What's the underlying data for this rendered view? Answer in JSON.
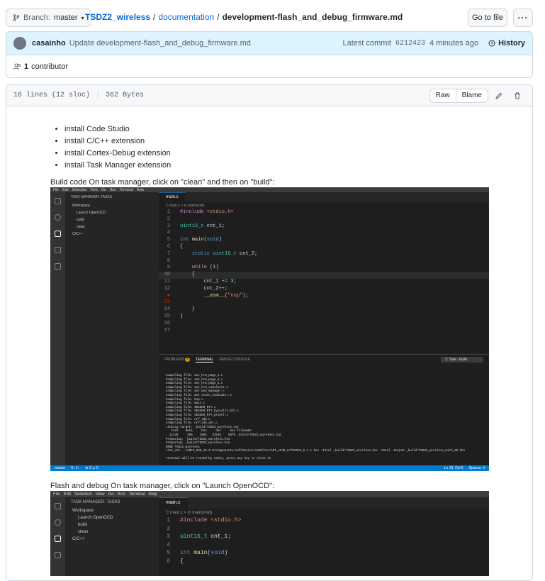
{
  "header": {
    "branch_label": "Branch:",
    "branch_name": "master",
    "repo": "TSDZ2_wireless",
    "folder": "documentation",
    "filename": "development-flash_and_debug_firmware.md",
    "goto_label": "Go to file",
    "more_label": "···"
  },
  "commit": {
    "user": "casainho",
    "message": "Update development-flash_and_debug_firmware.md",
    "latest_label": "Latest commit",
    "sha": "6212423",
    "time": "4 minutes ago",
    "history_label": "History"
  },
  "contributors": {
    "count": "1",
    "label": "contributor"
  },
  "file": {
    "lines": "16 lines (12 sloc)",
    "size": "362 Bytes",
    "raw_label": "Raw",
    "blame_label": "Blame"
  },
  "list": [
    "install Code Studio",
    "install C/C++ extension",
    "install Cortex-Debug extension",
    "install Task Manager extension"
  ],
  "para1": "Build code On task manager, click on \"clean\" and then on \"build\":",
  "para2": "Flash and debug On task manager, click on \"Launch OpenOCD\":",
  "vscode": {
    "menu": [
      "File",
      "Edit",
      "Selection",
      "View",
      "Go",
      "Run",
      "Terminal",
      "Help"
    ],
    "sidebar_title": "TASK MANAGER: TASKS",
    "sidebar_items": [
      "Workspace",
      "Launch OpenOCD",
      "build",
      "clean",
      "C/C++"
    ],
    "tab": "main.c",
    "crumb": "C main.c > ⊘ main(void)",
    "panel_tabs": [
      "PROBLEMS",
      "TERMINAL",
      "DEBUG CONSOLE"
    ],
    "problems_count": "2",
    "task_select": "1: Task - build",
    "status_left": "master",
    "status_sync": "0↓ 1↑",
    "status_err": "⊗ 2 ⚠ 0",
    "status_pos": "Ln 10, Col 6",
    "status_spaces": "Spaces: 4",
    "terminal": [
      "Compiling file: ant_hrm_page_2.c",
      "Compiling file: ant_hrm_page_3.c",
      "Compiling file: ant_hrm_page_4.c",
      "Compiling file: ant_hrm_simulator.c",
      "Compiling file: ant_key_manager.c",
      "Compiling file: ant_state_indicator.c",
      "Compiling file: bsp.c",
      "Compiling file: main.c",
      "Compiling file: SEGGER_RTT.c",
      "Compiling file: SEGGER_RTT_Syscalls_GCC.c",
      "Compiling file: SEGGER_RTT_printf.c",
      "Compiling file: nrf_sdh.c",
      "Compiling file: nrf_sdh_ant.c",
      "Linking target: _build/TSDZ2_wireless.out",
      "   text    data     bss     dec     hex filename",
      "  21436     100    1864   23536    5bf0 _build/TSDZ2_wireless.out",
      "Preparing: _build/TSDZ2_wireless.hex",
      "Preparing: _build/TSDZ2_wireless.bin",
      "DONE TSDZ2_wireless",
      "srec_cat ../nRF5_SDK_16.0.0/components/softdevice/s340/hex/ANT_s340_nrf52840_6.1.1.hex -Intel _build/TSDZ2_wireless.hex -Intel -Output _build/TSDZ2_wireless_with_SD.hex",
      "",
      "Terminal will be reused by tasks, press any key to close it."
    ]
  }
}
